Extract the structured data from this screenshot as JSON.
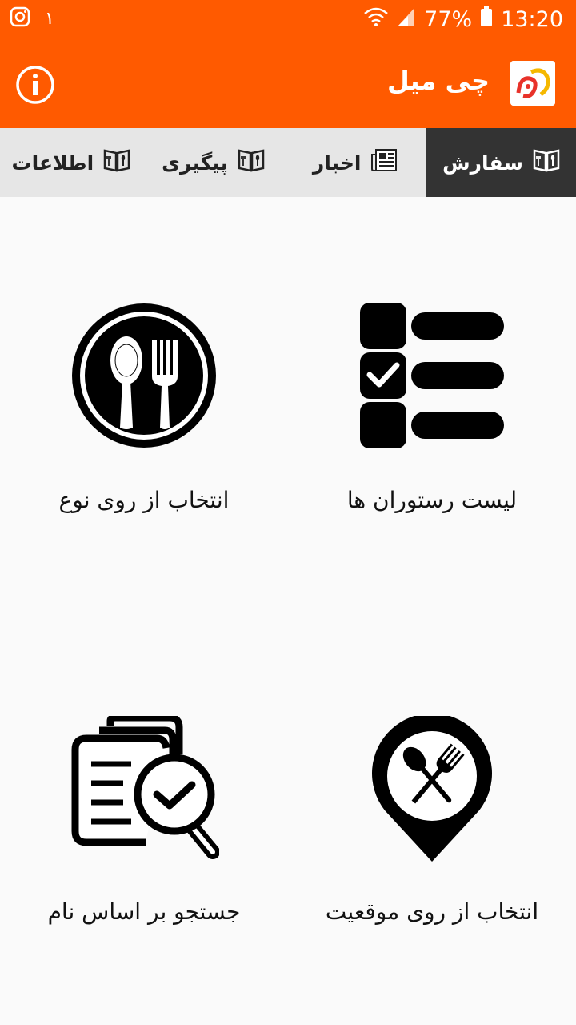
{
  "status": {
    "notification_count": "١",
    "battery": "77%",
    "time": "13:20"
  },
  "appbar": {
    "title": "چی میل",
    "logo_text": "چی میل"
  },
  "tabs": [
    {
      "label": "سفارش",
      "icon": "menu-book-icon",
      "active": true
    },
    {
      "label": "اخبار",
      "icon": "newspaper-icon",
      "active": false
    },
    {
      "label": "پیگیری",
      "icon": "menu-book-icon",
      "active": false
    },
    {
      "label": "اطلاعات",
      "icon": "menu-book-icon",
      "active": false
    }
  ],
  "main": {
    "items": [
      {
        "label": "لیست رستوران ها",
        "icon": "checklist-icon"
      },
      {
        "label": "انتخاب از روی نوع",
        "icon": "plate-spoon-fork-icon"
      },
      {
        "label": "انتخاب از روی موقعیت",
        "icon": "location-pin-food-icon"
      },
      {
        "label": "جستجو بر اساس نام",
        "icon": "search-document-icon"
      }
    ]
  },
  "colors": {
    "primary": "#ff5a00",
    "tab_active": "#333333",
    "tab_bar": "#e6e6e6"
  }
}
